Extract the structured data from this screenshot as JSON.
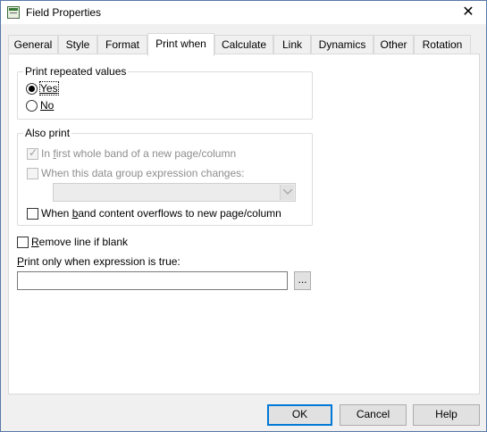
{
  "window": {
    "title": "Field Properties",
    "close_glyph": "✕"
  },
  "tabs": [
    {
      "label": "General"
    },
    {
      "label": "Style"
    },
    {
      "label": "Format"
    },
    {
      "label": "Print when"
    },
    {
      "label": "Calculate"
    },
    {
      "label": "Link"
    },
    {
      "label": "Dynamics"
    },
    {
      "label": "Other"
    },
    {
      "label": "Rotation"
    }
  ],
  "active_tab": "Print when",
  "print_repeated": {
    "group_label": "Print repeated values",
    "yes_label": "Yes",
    "no_label": "No",
    "selected": "Yes"
  },
  "also_print": {
    "group_label": "Also print",
    "first_band_label_pre": "In ",
    "first_band_label_mn": "f",
    "first_band_label_post": "irst whole band of a new page/column",
    "first_band_checked": true,
    "group_change_label": "When this data group expression changes:",
    "group_change_checked": false,
    "group_select_value": "",
    "band_overflow_pre": "When ",
    "band_overflow_mn": "b",
    "band_overflow_post": "and content overflows to new page/column",
    "band_overflow_checked": false
  },
  "remove_line": {
    "label_mn": "R",
    "label_post": "emove line if blank",
    "checked": false
  },
  "expression": {
    "label_mn": "P",
    "label_post": "rint only when expression is true:",
    "value": "",
    "browse_label": "..."
  },
  "buttons": {
    "ok": "OK",
    "cancel": "Cancel",
    "help": "Help"
  }
}
